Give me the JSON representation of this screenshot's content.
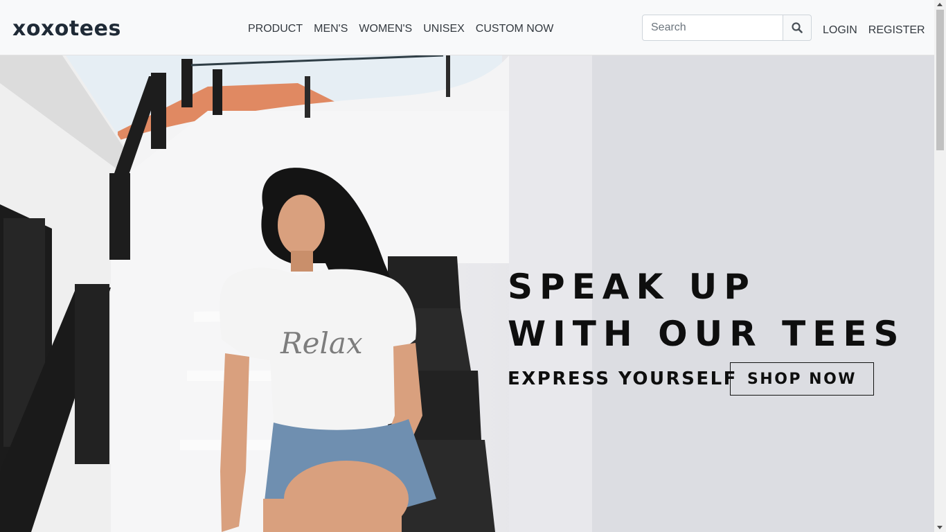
{
  "brand": {
    "logo_text": "xoxotees",
    "dark_color": "#1f2a36"
  },
  "nav": {
    "links": [
      "PRODUCT",
      "MEN'S",
      "WOMEN'S",
      "UNISEX",
      "CUSTOM NOW"
    ]
  },
  "search": {
    "placeholder": "Search",
    "value": "",
    "icon": "search-icon"
  },
  "auth": {
    "login": "LOGIN",
    "register": "REGISTER"
  },
  "hero": {
    "title_line1": "SPEAK UP",
    "title_line2": "WITH OUR TEES",
    "subtitle": "EXPRESS YOURSELF",
    "cta": "SHOP NOW",
    "shirt_text": "Relax"
  }
}
